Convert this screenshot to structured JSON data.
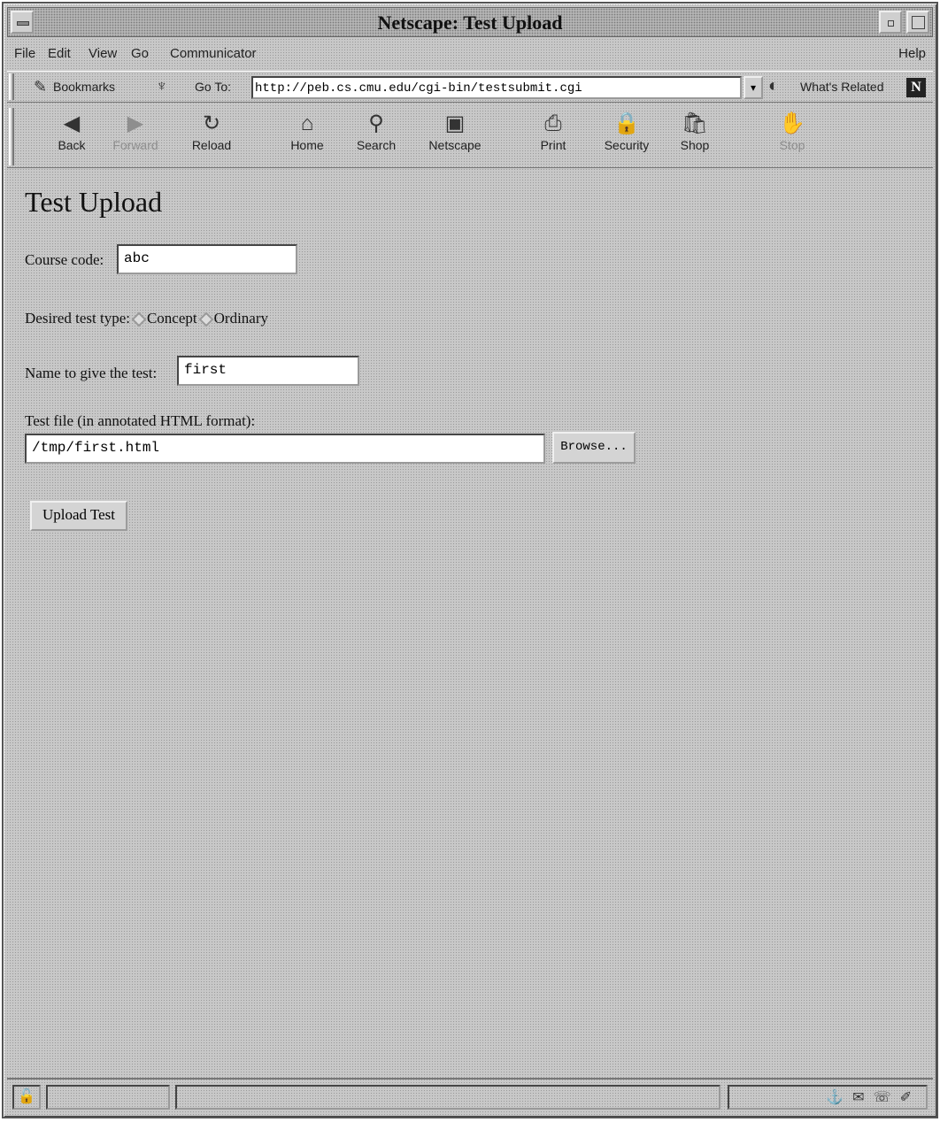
{
  "window": {
    "title": "Netscape: Test Upload"
  },
  "menubar": {
    "items": [
      "File",
      "Edit",
      "View",
      "Go",
      "Communicator"
    ],
    "help": "Help"
  },
  "location": {
    "bookmarks_label": "Bookmarks",
    "goto_label": "Go To:",
    "url": "http://peb.cs.cmu.edu/cgi-bin/testsubmit.cgi",
    "related_label": "What's Related",
    "logo": "N"
  },
  "toolbar": {
    "buttons": [
      {
        "label": "Back",
        "icon": "back-arrow-icon",
        "glyph": "◀"
      },
      {
        "label": "Forward",
        "icon": "forward-arrow-icon",
        "glyph": "▶"
      },
      {
        "label": "Reload",
        "icon": "reload-icon",
        "glyph": "↻"
      },
      {
        "label": "Home",
        "icon": "home-icon",
        "glyph": "⌂"
      },
      {
        "label": "Search",
        "icon": "search-icon",
        "glyph": "⚲"
      },
      {
        "label": "Netscape",
        "icon": "netscape-icon",
        "glyph": "▣"
      },
      {
        "label": "Print",
        "icon": "print-icon",
        "glyph": "⎙"
      },
      {
        "label": "Security",
        "icon": "security-lock-icon",
        "glyph": "🔒"
      },
      {
        "label": "Shop",
        "icon": "shop-icon",
        "glyph": "🛍"
      },
      {
        "label": "Stop",
        "icon": "stop-icon",
        "glyph": "✋"
      }
    ]
  },
  "page": {
    "title": "Test Upload",
    "course_code_label": "Course code:",
    "course_code_value": "abc",
    "test_type_label": "Desired test type:",
    "test_type_options": [
      "Concept",
      "Ordinary"
    ],
    "test_name_label": "Name to give the test:",
    "test_name_value": "first",
    "test_file_label": "Test file (in annotated HTML format):",
    "test_file_value": "/tmp/first.html",
    "browse_label": "Browse...",
    "submit_label": "Upload Test"
  },
  "colors": {
    "background": "#c8c8c8",
    "input_bg": "#ffffff",
    "text": "#111111"
  }
}
